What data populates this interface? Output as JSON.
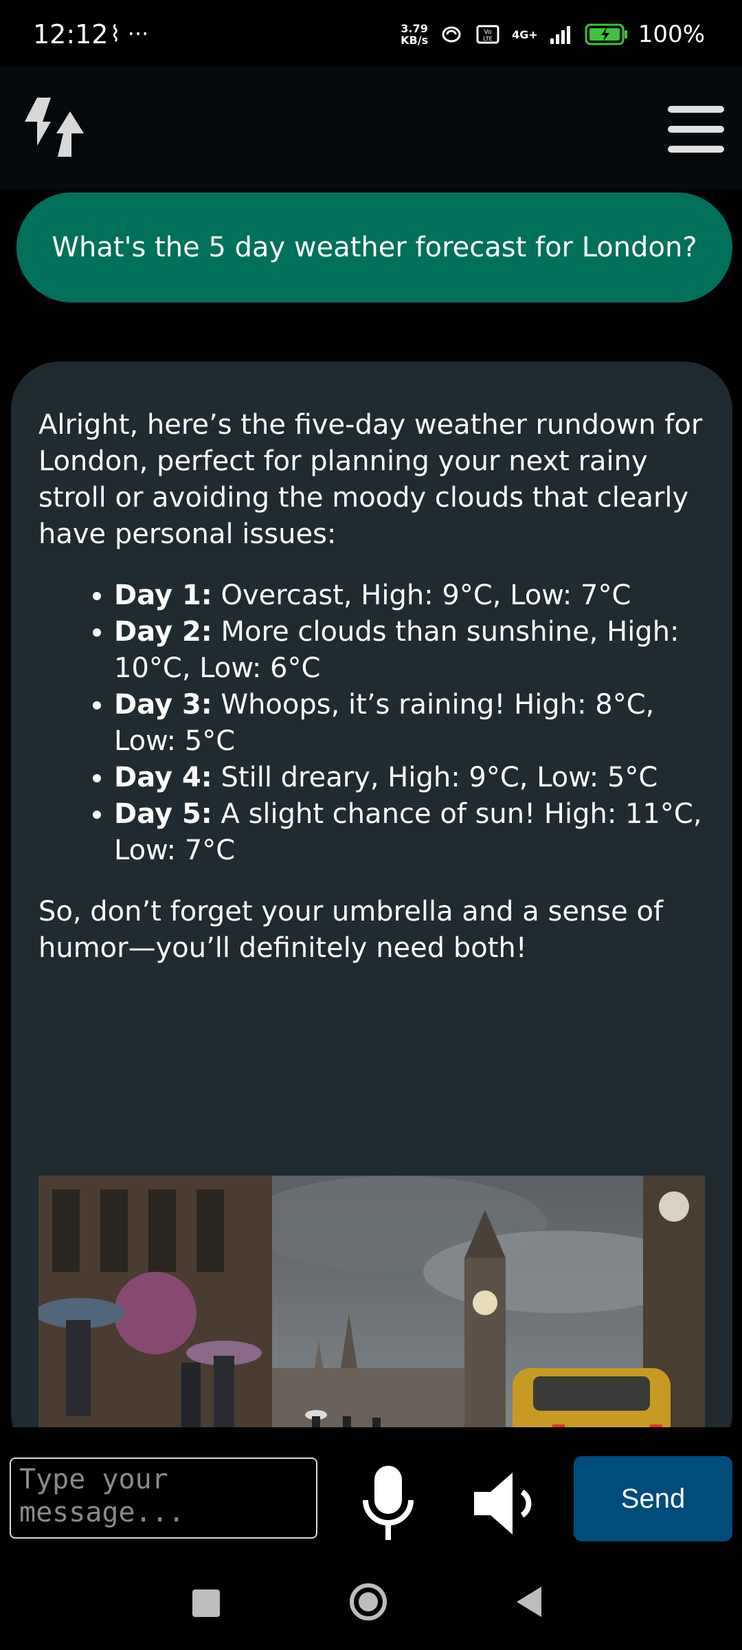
{
  "status_bar": {
    "time": "12:12",
    "left_icons": "⌇ ···",
    "speed_value": "3.79",
    "speed_unit": "KB/s",
    "network": "4G+",
    "battery": "100%"
  },
  "header": {
    "logo_icon": "refresh-arrows-icon",
    "menu_icon": "hamburger-menu-icon"
  },
  "conversation": {
    "user_message": "What's the 5 day weather forecast for London?",
    "bot_intro": "Alright, here’s the five-day weather rundown for London, perfect for planning your next rainy stroll or avoiding the moody clouds that clearly have personal issues:",
    "forecast": [
      {
        "day": "Day 1:",
        "text": " Overcast, High: 9°C, Low: 7°C"
      },
      {
        "day": "Day 2:",
        "text": " More clouds than sunshine, High: 10°C, Low: 6°C"
      },
      {
        "day": "Day 3:",
        "text": " Whoops, it’s raining! High: 8°C, Low: 5°C"
      },
      {
        "day": "Day 4:",
        "text": " Still dreary, High: 9°C, Low: 5°C"
      },
      {
        "day": "Day 5:",
        "text": " A slight chance of sun! High: 11°C, Low: 7°C"
      }
    ],
    "bot_outro": "So, don’t forget your umbrella and a sense of humor—you’ll definitely need both!",
    "image_subject": "rainy-london-street-big-ben"
  },
  "composer": {
    "placeholder": "Type your message...",
    "send_label": "Send",
    "mic_icon": "microphone-icon",
    "speaker_icon": "speaker-icon"
  },
  "colors": {
    "user_bubble": "#00705a",
    "bot_bubble": "#1f2b30",
    "send_button": "#004c7a"
  }
}
